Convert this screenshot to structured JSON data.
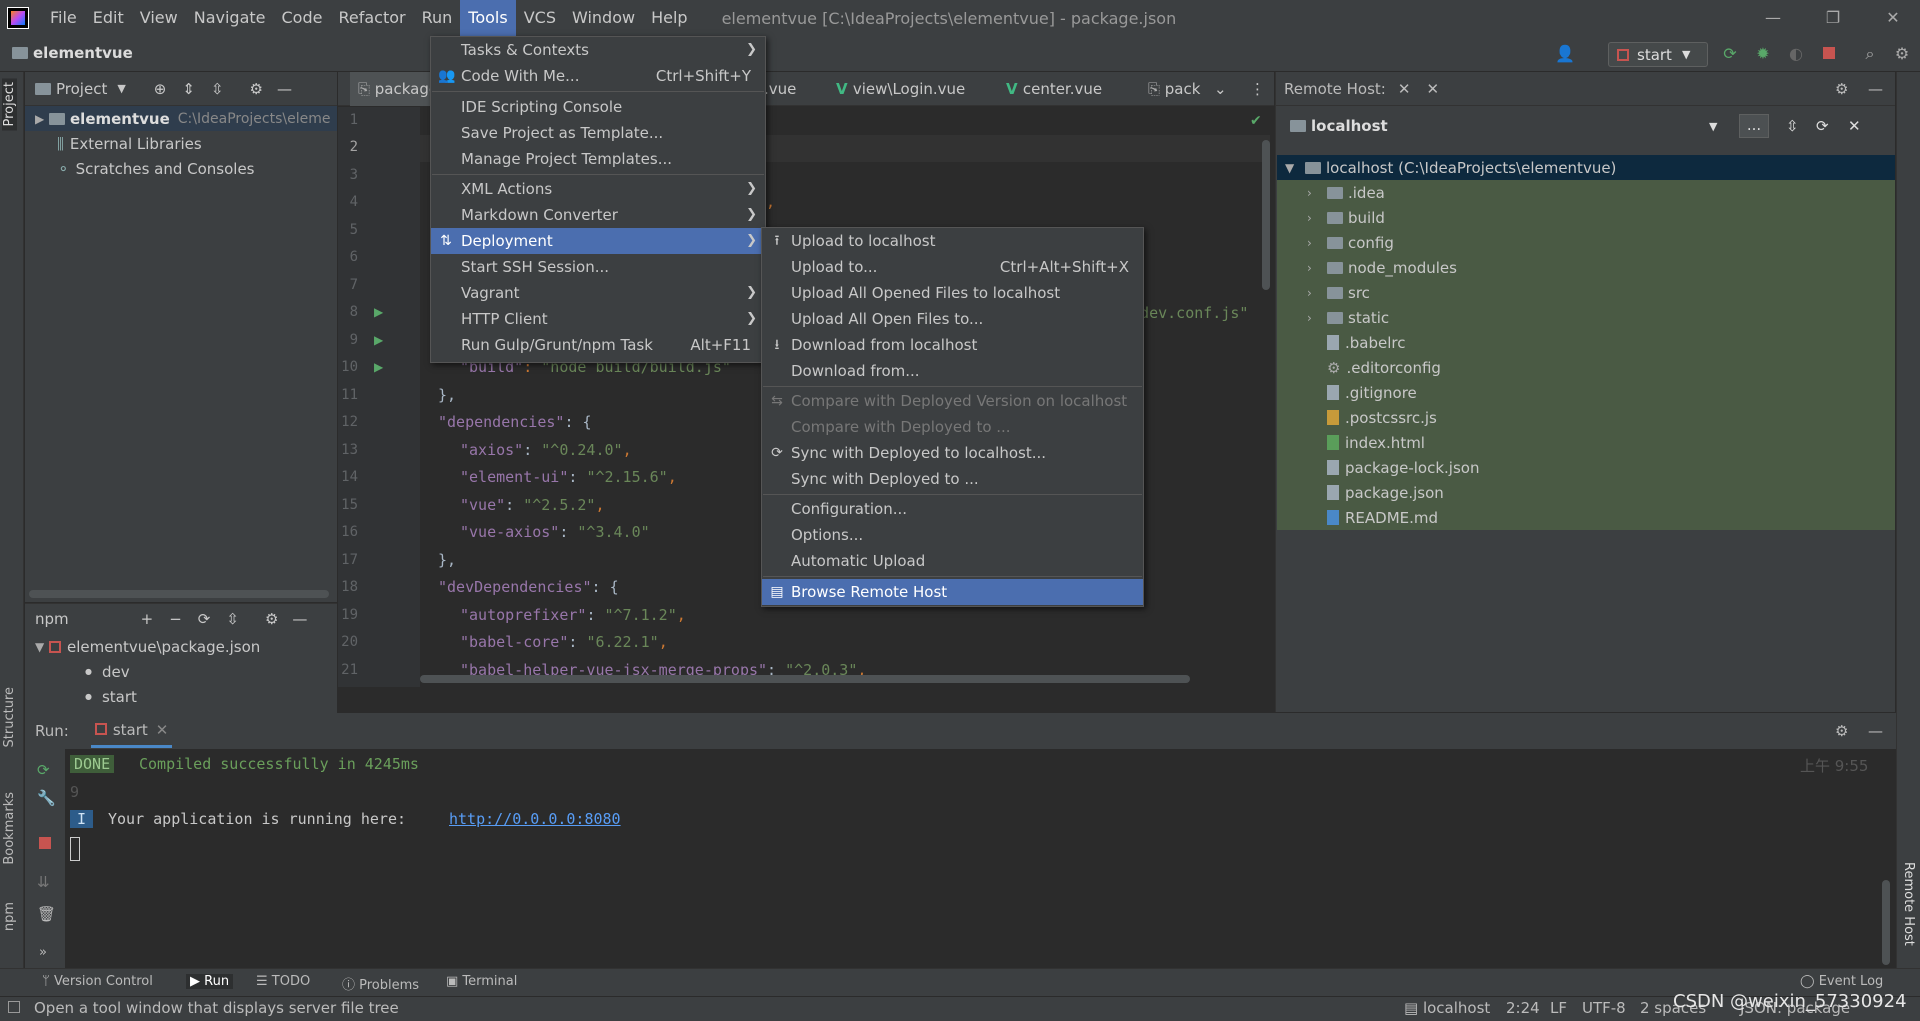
{
  "title_bar": {
    "menus": [
      "File",
      "Edit",
      "View",
      "Navigate",
      "Code",
      "Refactor",
      "Run",
      "Tools",
      "VCS",
      "Window",
      "Help"
    ],
    "active_menu": "Tools",
    "window_title": "elementvue [C:\\IdeaProjects\\elementvue] - package.json"
  },
  "nav": {
    "project_name": "elementvue",
    "run_config": "start"
  },
  "left_strip": {
    "project": "Project",
    "structure": "Structure",
    "bookmarks": "Bookmarks",
    "npm": "npm"
  },
  "right_strip": {
    "remote_host": "Remote Host"
  },
  "project_panel": {
    "title": "Project",
    "root_name": "elementvue",
    "root_path": "C:\\IdeaProjects\\eleme",
    "items": [
      "External Libraries",
      "Scratches and Consoles"
    ]
  },
  "npm_panel": {
    "title": "npm",
    "file": "elementvue\\package.json",
    "scripts": [
      "dev",
      "start"
    ]
  },
  "editor_tabs": [
    "package",
    ".vue",
    "view\\Login.vue",
    "center.vue",
    "pack"
  ],
  "code": {
    "line_numbers": [
      "1",
      "2",
      "3",
      "4",
      "5",
      "6",
      "7",
      "8",
      "9",
      "10",
      "11",
      "12",
      "13",
      "14",
      "15",
      "16",
      "17",
      "18",
      "19",
      "20",
      "21"
    ],
    "line1": "{",
    "frag_line4": ",",
    "frag_line8": "k.dev.conf.js\"",
    "line10_key": "\"build\"",
    "line10_val": "\"node build/build.js\"",
    "line11": "},",
    "line12_key": "\"dependencies\"",
    "line13_key": "\"axios\"",
    "line13_val": "\"^0.24.0\"",
    "line14_key": "\"element-ui\"",
    "line14_val": "\"^2.15.6\"",
    "line15_key": "\"vue\"",
    "line15_val": "\"^2.5.2\"",
    "line16_key": "\"vue-axios\"",
    "line16_val": "\"^3.4.0\"",
    "line17": "},",
    "line18_key": "\"devDependencies\"",
    "line19_key": "\"autoprefixer\"",
    "line19_val": "\"^7.1.2\"",
    "line20_key": "\"babel-core\"",
    "line20_val": "\"6.22.1\"",
    "line21_key": "\"babel-helper-vue-jsx-merge-props\"",
    "line21_val": "\"^2.0.3\""
  },
  "tools_menu": {
    "items": [
      {
        "label": "Tasks & Contexts",
        "shortcut": "",
        "submenu": true
      },
      {
        "label": "Code With Me...",
        "shortcut": "Ctrl+Shift+Y",
        "submenu": false
      },
      {
        "label": "IDE Scripting Console",
        "shortcut": "",
        "submenu": false
      },
      {
        "label": "Save Project as Template...",
        "shortcut": "",
        "submenu": false
      },
      {
        "label": "Manage Project Templates...",
        "shortcut": "",
        "submenu": false
      },
      {
        "label": "XML Actions",
        "shortcut": "",
        "submenu": true
      },
      {
        "label": "Markdown Converter",
        "shortcut": "",
        "submenu": true
      },
      {
        "label": "Deployment",
        "shortcut": "",
        "submenu": true
      },
      {
        "label": "Start SSH Session...",
        "shortcut": "",
        "submenu": false
      },
      {
        "label": "Vagrant",
        "shortcut": "",
        "submenu": true
      },
      {
        "label": "HTTP Client",
        "shortcut": "",
        "submenu": true
      },
      {
        "label": "Run Gulp/Grunt/npm Task",
        "shortcut": "Alt+F11",
        "submenu": false
      }
    ]
  },
  "deployment_menu": {
    "items": [
      {
        "label": "Upload to localhost",
        "shortcut": ""
      },
      {
        "label": "Upload to...",
        "shortcut": "Ctrl+Alt+Shift+X"
      },
      {
        "label": "Upload All Opened Files to localhost",
        "shortcut": ""
      },
      {
        "label": "Upload All Open Files to...",
        "shortcut": ""
      },
      {
        "label": "Download from localhost",
        "shortcut": ""
      },
      {
        "label": "Download from...",
        "shortcut": ""
      },
      {
        "label": "Compare with Deployed Version on localhost",
        "shortcut": ""
      },
      {
        "label": "Compare with Deployed to ...",
        "shortcut": ""
      },
      {
        "label": "Sync with Deployed to localhost...",
        "shortcut": ""
      },
      {
        "label": "Sync with Deployed to ...",
        "shortcut": ""
      },
      {
        "label": "Configuration...",
        "shortcut": ""
      },
      {
        "label": "Options...",
        "shortcut": ""
      },
      {
        "label": "Automatic Upload",
        "shortcut": ""
      },
      {
        "label": "Browse Remote Host",
        "shortcut": ""
      }
    ]
  },
  "remote_panel": {
    "title": "Remote Host:",
    "server": "localhost",
    "more": "...",
    "root": "localhost (C:\\IdeaProjects\\elementvue)",
    "folders": [
      ".idea",
      "build",
      "config",
      "node_modules",
      "src",
      "static"
    ],
    "files": [
      ".babelrc",
      ".editorconfig",
      ".gitignore",
      ".postcssrc.js",
      "index.html",
      "package-lock.json",
      "package.json",
      "README.md"
    ]
  },
  "run_panel": {
    "label": "Run:",
    "tab": "start",
    "done_badge": "DONE",
    "compiled": "Compiled successfully in 4245ms",
    "timestamp": "上午 9:55",
    "line_9": "9",
    "info_badge": "I",
    "running_text": "Your application is running here: ",
    "url": "http://0.0.0.0:8080"
  },
  "bottom_tabs": [
    "Version Control",
    "Run",
    "TODO",
    "Problems",
    "Terminal"
  ],
  "event_log": "Event Log",
  "status": {
    "message": "Open a tool window that displays server file tree",
    "server": "localhost",
    "position": "2:24",
    "line_sep": "LF",
    "encoding": "UTF-8",
    "indent": "2 spaces",
    "schema": "JSON: package",
    "watermark": "CSDN @weixin_57330924"
  }
}
